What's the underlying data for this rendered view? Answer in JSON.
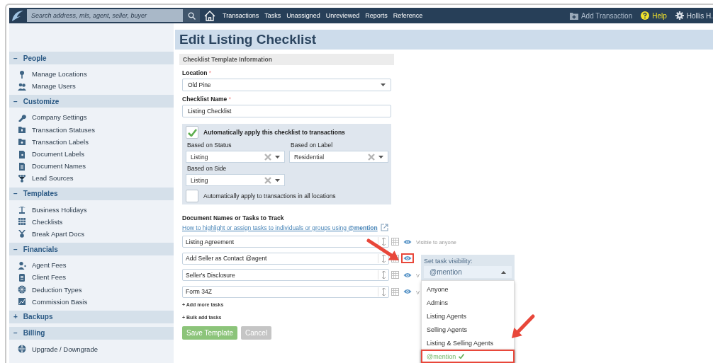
{
  "topbar": {
    "search_placeholder": "Search address, mls, agent, seller, buyer",
    "nav": [
      "Transactions",
      "Tasks",
      "Unassigned",
      "Unreviewed",
      "Reports",
      "Reference"
    ],
    "add_transaction": "Add Transaction",
    "help": "Help",
    "user": "Hollis H."
  },
  "sidebar": {
    "sections": [
      {
        "toggle": "−",
        "title": "People",
        "items": [
          "Manage Locations",
          "Manage Users"
        ]
      },
      {
        "toggle": "−",
        "title": "Customize",
        "items": [
          "Company Settings",
          "Transaction Statuses",
          "Transaction Labels",
          "Document Labels",
          "Document Names",
          "Lead Sources"
        ]
      },
      {
        "toggle": "−",
        "title": "Templates",
        "items": [
          "Business Holidays",
          "Checklists",
          "Break Apart Docs"
        ]
      },
      {
        "toggle": "−",
        "title": "Financials",
        "items": [
          "Agent Fees",
          "Client Fees",
          "Deduction Types",
          "Commission Basis"
        ]
      },
      {
        "toggle": "+",
        "title": "Backups"
      },
      {
        "toggle": "−",
        "title": "Billing",
        "items": [
          "Upgrade / Downgrade"
        ]
      }
    ]
  },
  "page": {
    "title": "Edit Listing Checklist",
    "template_info": {
      "header": "Checklist Template Information",
      "location": {
        "label": "Location",
        "required": "*",
        "value": "Old Pine"
      },
      "name": {
        "label": "Checklist Name",
        "required": "*",
        "value": "Listing Checklist"
      },
      "auto_apply": {
        "checked": true,
        "label": "Automatically apply this checklist to transactions",
        "fields": [
          {
            "label": "Based on Status",
            "value": "Listing"
          },
          {
            "label": "Based on Label",
            "value": "Residential"
          },
          {
            "label": "Based on Side",
            "value": "Listing"
          }
        ],
        "all_locations": {
          "checked": false,
          "label": "Automatically apply to transactions in all locations"
        }
      }
    },
    "tasks": {
      "heading": "Document Names or Tasks to Track",
      "help_link": "How to highlight or assign tasks to individuals or groups using **@mention**",
      "items": [
        {
          "value": "Listing Agreement",
          "visibility_label": "Visible to anyone",
          "highlighted": false
        },
        {
          "value": "Add Seller as Contact @agent",
          "highlighted": true
        },
        {
          "value": "Seller's Disclosure",
          "visibility_label": "V",
          "highlighted": false
        },
        {
          "value": "Form 34Z",
          "visibility_label": "V",
          "highlighted": false
        }
      ],
      "add_more": "+ Add more tasks",
      "bulk_add": "+ Bulk add tasks"
    },
    "visibility_menu": {
      "title": "Set task visibility:",
      "value": "@mention",
      "options": [
        {
          "label": "Anyone",
          "selected": false,
          "highlighted": false
        },
        {
          "label": "Admins",
          "selected": false,
          "highlighted": false
        },
        {
          "label": "Listing Agents",
          "selected": false,
          "highlighted": false
        },
        {
          "label": "Selling Agents",
          "selected": false,
          "highlighted": false
        },
        {
          "label": "Listing & Selling Agents",
          "selected": false,
          "highlighted": false
        },
        {
          "label": "@mention",
          "selected": true,
          "highlighted": true
        }
      ]
    },
    "buttons": {
      "save": "Save Template",
      "cancel": "Cancel"
    }
  }
}
